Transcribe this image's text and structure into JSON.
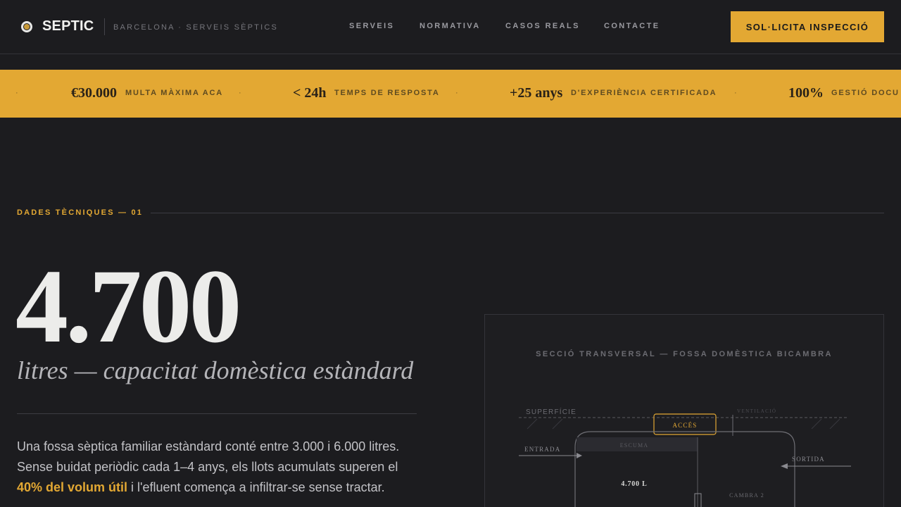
{
  "header": {
    "brand": "SEPTIC",
    "tagline": "BARCELONA · SERVEIS SÈPTICS",
    "nav": [
      "SERVEIS",
      "NORMATIVA",
      "CASOS REALS",
      "CONTACTE"
    ],
    "cta": "SOL·LICITA INSPECCIÓ"
  },
  "ticker": {
    "items": [
      {
        "value": "€30.000",
        "label": "MULTA MÀXIMA ACA"
      },
      {
        "value": "< 24h",
        "label": "TEMPS DE RESPOSTA"
      },
      {
        "value": "+25 anys",
        "label": "D'EXPERIÈNCIA CERTIFICADA"
      },
      {
        "value": "100%",
        "label": "GESTIÓ DOCU"
      }
    ],
    "separator": "·"
  },
  "section": {
    "label": "DADES TÈCNIQUES — 01",
    "big_number": "4.700",
    "subtitle": "litres — capacitat domèstica estàndard",
    "body_before": "Una fossa sèptica familiar estàndard conté entre 3.000 i 6.000 litres. Sense buidat periòdic cada 1–4 anys, els llots acumulats superen el ",
    "body_highlight": "40% del volum útil",
    "body_after": " i l'efluent comença a infiltrar-se sense tractar."
  },
  "diagram": {
    "title": "SECCIÓ TRANSVERSAL — FOSSA DOMÈSTICA BICAMBRA",
    "labels": {
      "surface": "SUPERFÍCIE",
      "vent": "VENTILACIÓ",
      "access": "ACCÉS",
      "inlet": "ENTRADA",
      "scum": "ESCUMA",
      "outlet": "SORTIDA",
      "volume": "4.700 L",
      "chamber2": "CAMBRA 2"
    }
  },
  "colors": {
    "accent": "#e3a833",
    "background": "#1c1c1f",
    "text": "#ececea"
  }
}
